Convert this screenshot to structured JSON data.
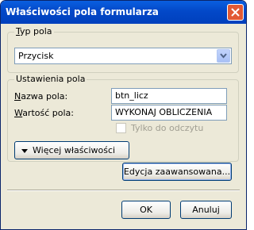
{
  "window": {
    "title": "Właściwości pola formularza"
  },
  "field_type": {
    "legend": "Typ pola",
    "selected": "Przycisk"
  },
  "field_settings": {
    "legend": "Ustawienia pola",
    "name_label": "Nazwa pola:",
    "name_value": "btn_licz",
    "value_label": "Wartość pola:",
    "value_value": "WYKONAJ OBLICZENIA",
    "readonly_label": "Tylko do odczytu",
    "readonly_checked": false,
    "more_button": "Więcej właściwości"
  },
  "buttons": {
    "advanced": "Edycja zaawansowana...",
    "ok": "OK",
    "cancel": "Anuluj"
  },
  "icons": {
    "close": "close-icon",
    "dropdown": "chevron-down-icon",
    "more": "triangle-down-icon"
  },
  "colors": {
    "titlebar": "#0348c8",
    "close_button": "#e25a35",
    "dialog_bg": "#ece9d8"
  }
}
